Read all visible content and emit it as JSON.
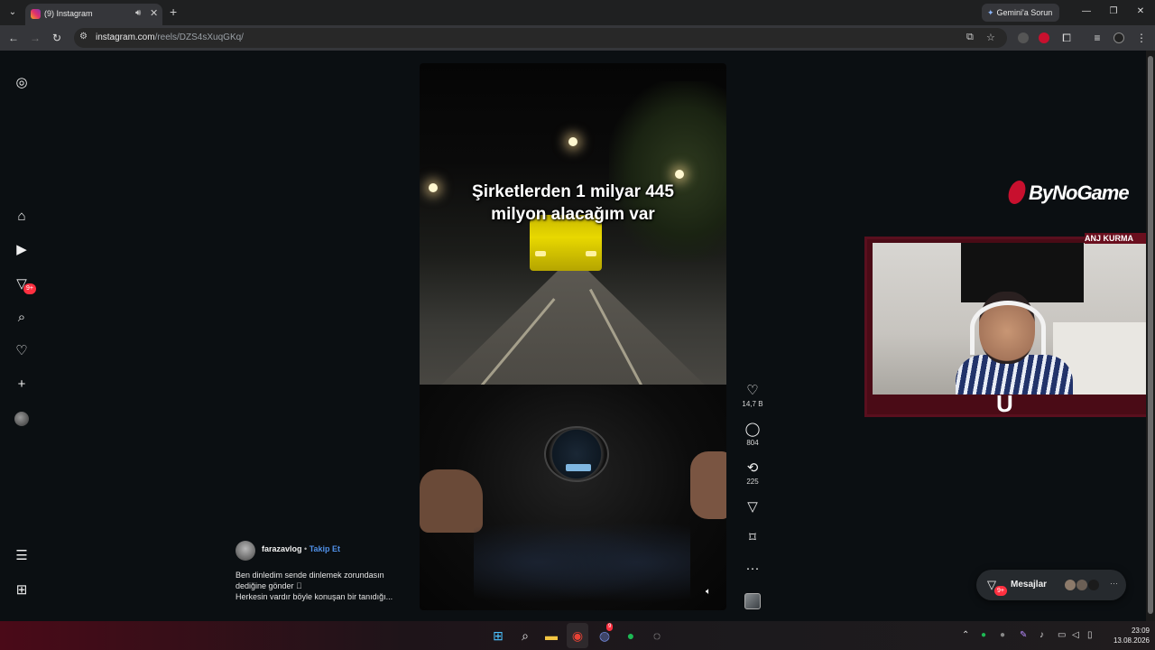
{
  "browser": {
    "tab_title": "(9) Instagram",
    "gemini_label": "Gemini'a Sorun",
    "url_host": "instagram.com",
    "url_path": "/reels/DZS4sXuqGKq/"
  },
  "reel": {
    "overlay_line1": "Şirketlerden 1 milyar 445",
    "overlay_line2": "milyon alacağım var",
    "likes": "14,7 B",
    "comments": "804",
    "reposts": "225",
    "author": "farazavlog",
    "separator": "•",
    "follow_label": "Takip Et",
    "caption_line1": "Ben dinledim sende dinlemek zorundasın",
    "caption_line2": "dediğine gönder 🏻",
    "caption_line3": "Herkesin vardır böyle konuşan bir tanıdığı..."
  },
  "sidebar": {
    "notifications_badge": "9+"
  },
  "messages": {
    "label": "Mesajlar",
    "badge": "9+"
  },
  "stream_overlay": {
    "brand": "ByNoGame",
    "ticker": "ANJ  KURMA"
  },
  "taskbar": {
    "time": "23:09",
    "date": "13.08.2026",
    "discord_badge": "9"
  },
  "icons": {
    "like": "heart-icon",
    "comment": "comment-icon",
    "repost": "repost-icon",
    "share": "send-icon",
    "save": "bookmark-icon",
    "more": "more-icon"
  },
  "colors": {
    "follow": "#4f8fe6",
    "badge": "#ff3040",
    "stream_accent": "#c8102e"
  }
}
